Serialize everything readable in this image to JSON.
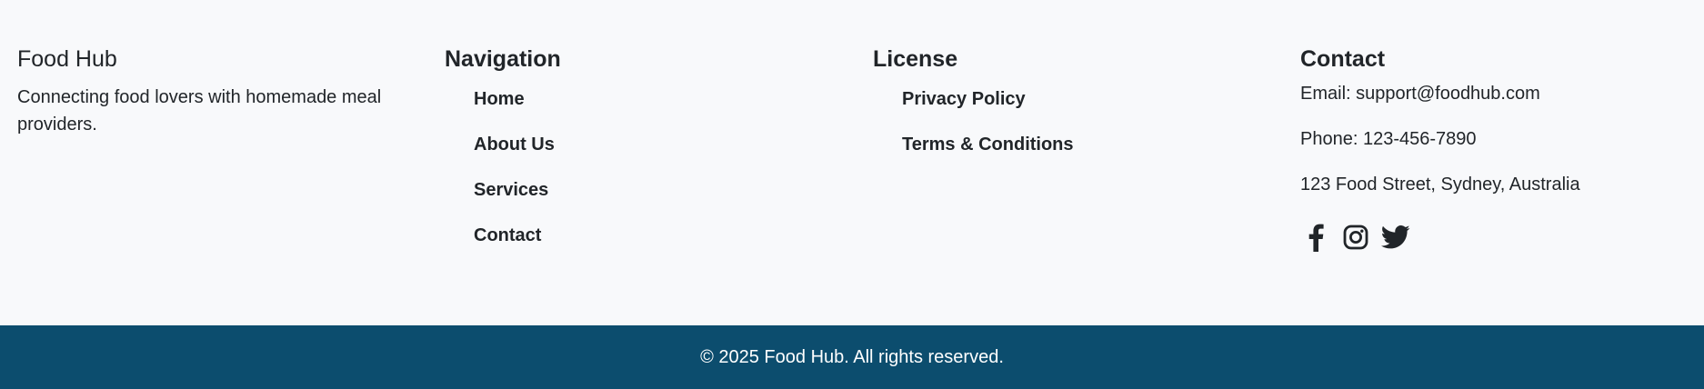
{
  "brand": {
    "title": "Food Hub",
    "description": "Connecting food lovers with homemade meal providers."
  },
  "navigation": {
    "heading": "Navigation",
    "links": [
      "Home",
      "About Us",
      "Services",
      "Contact"
    ]
  },
  "license": {
    "heading": "License",
    "links": [
      "Privacy Policy",
      "Terms & Conditions"
    ]
  },
  "contact": {
    "heading": "Contact",
    "email": "Email: support@foodhub.com",
    "phone": "Phone: 123-456-7890",
    "address": "123 Food Street, Sydney, Australia",
    "social_icons": [
      "facebook-icon",
      "instagram-icon",
      "twitter-icon"
    ]
  },
  "footer_bar": {
    "copyright": "© 2025 Food Hub. All rights reserved.",
    "background_color": "#0c4d6e"
  },
  "colors": {
    "page_background": "#f8f9fb",
    "text": "#212529"
  }
}
